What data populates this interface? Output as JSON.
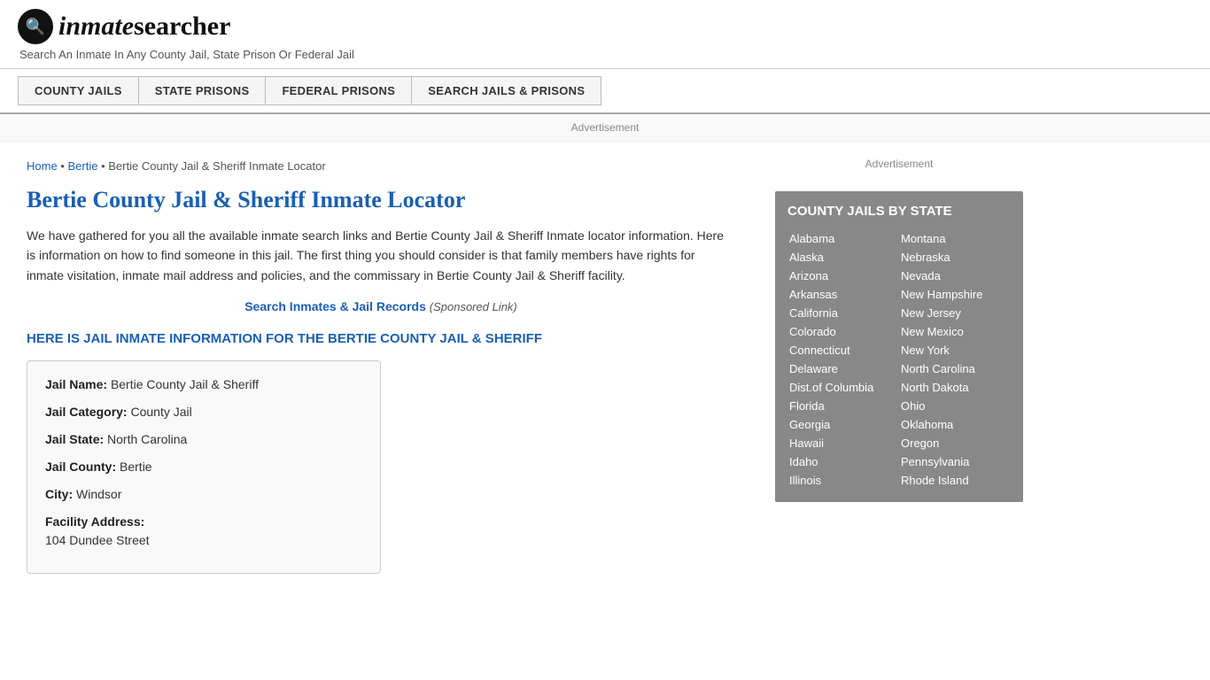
{
  "header": {
    "logo_icon": "🔍",
    "logo_text_inmate": "inmate",
    "logo_text_searcher": "searcher",
    "tagline": "Search An Inmate In Any County Jail, State Prison Or Federal Jail"
  },
  "nav": {
    "buttons": [
      {
        "label": "COUNTY JAILS",
        "id": "county-jails"
      },
      {
        "label": "STATE PRISONS",
        "id": "state-prisons"
      },
      {
        "label": "FEDERAL PRISONS",
        "id": "federal-prisons"
      },
      {
        "label": "SEARCH JAILS & PRISONS",
        "id": "search-jails"
      }
    ]
  },
  "ad_banner": "Advertisement",
  "breadcrumb": {
    "home": "Home",
    "parent": "Bertie",
    "current": "Bertie County Jail & Sheriff Inmate Locator"
  },
  "page": {
    "title": "Bertie County Jail & Sheriff Inmate Locator",
    "description": "We have gathered for you all the available inmate search links and Bertie County Jail & Sheriff Inmate locator information. Here is information on how to find someone in this jail. The first thing you should consider is that family members have rights for inmate visitation, inmate mail address and policies, and the commissary in Bertie County Jail & Sheriff facility.",
    "sponsored_link_text": "Search Inmates & Jail Records",
    "sponsored_note": "(Sponsored Link)",
    "info_header": "HERE IS JAIL INMATE INFORMATION FOR THE BERTIE COUNTY JAIL & SHERIFF"
  },
  "jail_info": {
    "name_label": "Jail Name:",
    "name_value": "Bertie County Jail & Sheriff",
    "category_label": "Jail Category:",
    "category_value": "County Jail",
    "state_label": "Jail State:",
    "state_value": "North Carolina",
    "county_label": "Jail County:",
    "county_value": "Bertie",
    "city_label": "City:",
    "city_value": "Windsor",
    "address_label": "Facility Address:",
    "address_value": "104 Dundee Street"
  },
  "sidebar": {
    "ad_label": "Advertisement",
    "state_box_title": "COUNTY JAILS BY STATE",
    "states_left": [
      "Alabama",
      "Alaska",
      "Arizona",
      "Arkansas",
      "California",
      "Colorado",
      "Connecticut",
      "Delaware",
      "Dist.of Columbia",
      "Florida",
      "Georgia",
      "Hawaii",
      "Idaho",
      "Illinois"
    ],
    "states_right": [
      "Montana",
      "Nebraska",
      "Nevada",
      "New Hampshire",
      "New Jersey",
      "New Mexico",
      "New York",
      "North Carolina",
      "North Dakota",
      "Ohio",
      "Oklahoma",
      "Oregon",
      "Pennsylvania",
      "Rhode Island"
    ]
  }
}
